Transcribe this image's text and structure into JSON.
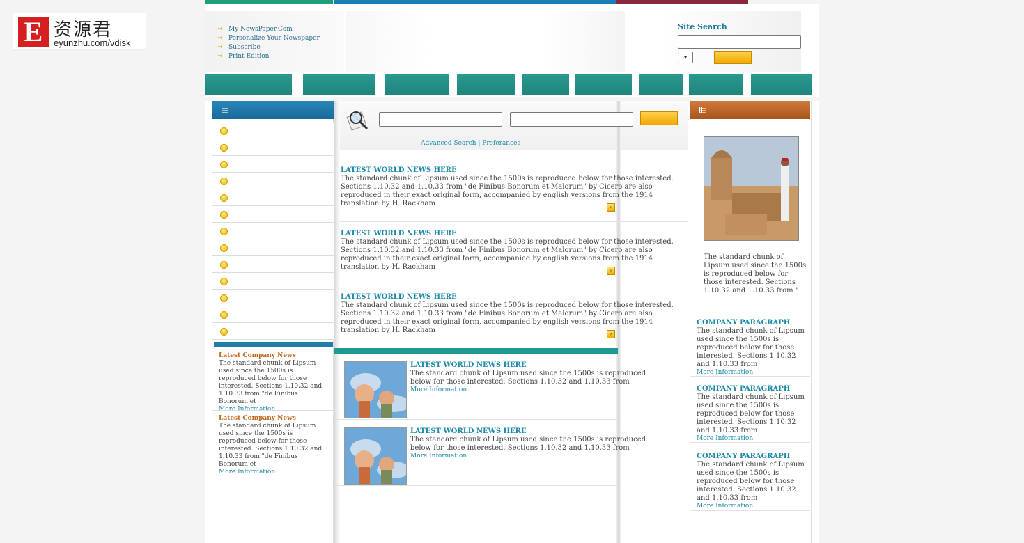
{
  "logo": {
    "letter": "E",
    "chinese": "资源君",
    "url": "eyunzhu.com/vdisk"
  },
  "colors": {
    "stripe_green": "#20a07a",
    "stripe_blue": "#1b7fb5",
    "stripe_maroon": "#8a2840",
    "nav_teal": "#1f857d",
    "link": "#1a8aa8",
    "accent_orange": "#c0661a"
  },
  "top_links": [
    "My NewsPaper.Com",
    "Personalize Your Newspaper",
    "Subscribe",
    "Print Edition"
  ],
  "site_search": {
    "label": "Site Search",
    "value": ""
  },
  "center_search": {
    "advanced": "Advanced Search",
    "separator": "|",
    "preferences": "Preferances"
  },
  "articles": [
    {
      "title": "LATEST WORLD NEWS HERE",
      "body": "The standard chunk of Lipsum used since the 1500s is reproduced below for those interested. Sections 1.10.32 and 1.10.33 from \"de Finibus Bonorum et Malorum\" by Cicero are also reproduced in their exact original form, accompanied by english versions from the 1914 translation by H. Rackham"
    },
    {
      "title": "LATEST WORLD NEWS HERE",
      "body": "The standard chunk of Lipsum used since the 1500s is reproduced below for those interested. Sections 1.10.32 and 1.10.33 from \"de Finibus Bonorum et Malorum\" by Cicero are also reproduced in their exact original form, accompanied by english versions from the 1914 translation by H. Rackham"
    },
    {
      "title": "LATEST WORLD NEWS HERE",
      "body": "The standard chunk of Lipsum used since the 1500s is reproduced below for those interested. Sections 1.10.32 and 1.10.33 from \"de Finibus Bonorum et Malorum\" by Cicero are also reproduced in their exact original form, accompanied by english versions from the 1914 translation by H. Rackham"
    }
  ],
  "thumb_articles": [
    {
      "title": "LATEST WORLD NEWS HERE",
      "body": "The standard chunk of Lipsum used since the 1500s is reproduced below for those interested. Sections 1.10.32 and 1.10.33 from",
      "more": "More Information"
    },
    {
      "title": "LATEST WORLD NEWS HERE",
      "body": "The standard chunk of Lipsum used since the 1500s is reproduced below for those interested. Sections 1.10.32 and 1.10.33 from",
      "more": "More Information"
    }
  ],
  "left_news": [
    {
      "title": "Latest Company News",
      "body": "The standard chunk of Lipsum used since the 1500s is reproduced below for those interested. Sections 1.10.32 and 1.10.33 from \"de Finibus Bonorum et",
      "more": "More Information"
    },
    {
      "title": "Latest Company News",
      "body": "The standard chunk of Lipsum used since the 1500s is reproduced below for those interested. Sections 1.10.32 and 1.10.33 from \"de Finibus Bonorum et",
      "more": "More Information"
    }
  ],
  "right_caption": "The standard chunk of Lipsum used since the 1500s is reproduced below for those interested. Sections 1.10.32 and 1.10.33 from \"",
  "company_paragraphs": [
    {
      "title": "COMPANY PARAGRAPH",
      "body": "The standard chunk of Lipsum used since the 1500s is reproduced below for those interested. Sections 1.10.32 and 1.10.33 from",
      "more": "More Information"
    },
    {
      "title": "COMPANY PARAGRAPH",
      "body": "The standard chunk of Lipsum used since the 1500s is reproduced below for those interested. Sections 1.10.32 and 1.10.33 from",
      "more": "More Information"
    },
    {
      "title": "COMPANY PARAGRAPH",
      "body": "The standard chunk of Lipsum used since the 1500s is reproduced below for those interested. Sections 1.10.32 and 1.10.33 from",
      "more": "More Information"
    }
  ]
}
